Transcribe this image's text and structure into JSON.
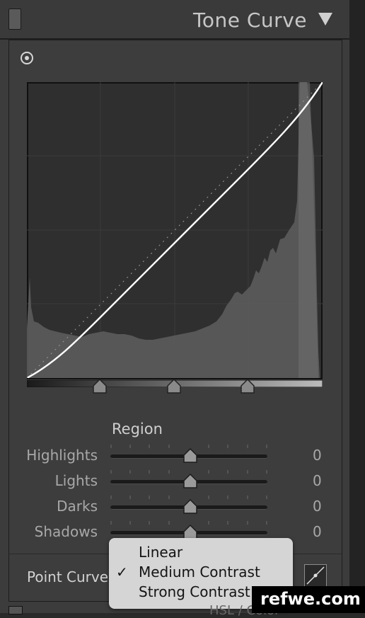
{
  "header": {
    "title": "Tone Curve"
  },
  "region": {
    "title": "Region",
    "sliders": [
      {
        "label": "Highlights",
        "value": "0"
      },
      {
        "label": "Lights",
        "value": "0"
      },
      {
        "label": "Darks",
        "value": "0"
      },
      {
        "label": "Shadows",
        "value": "0"
      }
    ]
  },
  "point_curve": {
    "label": "Point Curve",
    "options": [
      {
        "label": "Linear",
        "checked": false
      },
      {
        "label": "Medium Contrast",
        "checked": true
      },
      {
        "label": "Strong Contrast",
        "checked": false
      }
    ],
    "check_mark": "✓"
  },
  "watermark": "refwe.com",
  "next_panel_title": "HSL / Color",
  "colors": {
    "panel": "#3d3d3d",
    "curve": "#ffffff",
    "histogram": "#5c5c5c",
    "dropdown": "#d5d5d5"
  },
  "icons": [
    "target-adjustment-icon",
    "collapse-triangle-icon",
    "point-curve-edit-icon",
    "checkmark-icon"
  ]
}
